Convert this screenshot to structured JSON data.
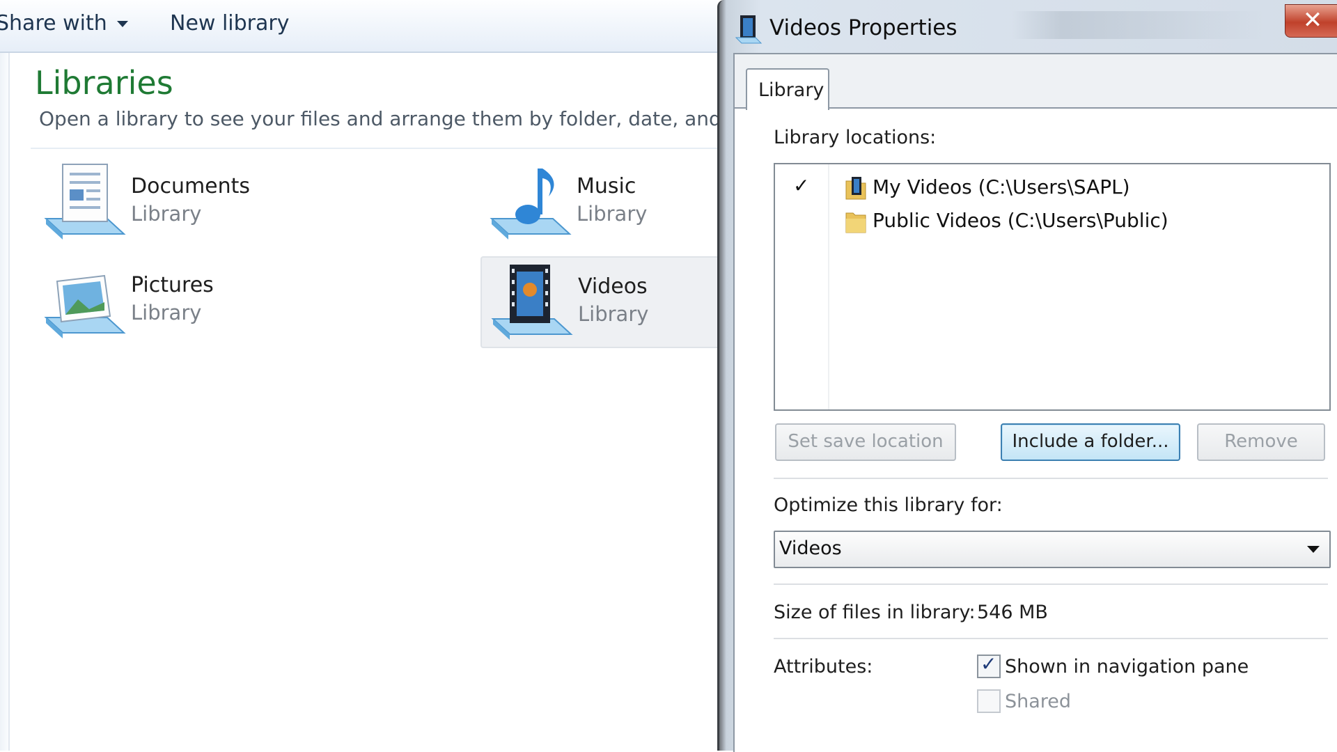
{
  "explorer": {
    "toolbar": {
      "share_with": "Share with",
      "new_library": "New library"
    },
    "title": "Libraries",
    "subtitle": "Open a library to see your files and arrange them by folder, date, and othe",
    "libraries": [
      {
        "name": "Documents",
        "type": "Library",
        "icon": "documents-library-icon"
      },
      {
        "name": "Music",
        "type": "Library",
        "icon": "music-library-icon"
      },
      {
        "name": "Pictures",
        "type": "Library",
        "icon": "pictures-library-icon"
      },
      {
        "name": "Videos",
        "type": "Library",
        "icon": "videos-library-icon",
        "selected": true
      }
    ]
  },
  "dialog": {
    "title": "Videos Properties",
    "close_glyph": "✕",
    "tab": "Library",
    "locations_label": "Library locations:",
    "locations": [
      {
        "check": "✓",
        "text": "My Videos (C:\\Users\\SAPL)",
        "icon": "videos-folder-icon"
      },
      {
        "check": "",
        "text": "Public Videos (C:\\Users\\Public)",
        "icon": "folder-icon"
      }
    ],
    "buttons": {
      "set_save": "Set save location",
      "include": "Include a folder...",
      "remove": "Remove"
    },
    "optimize_label": "Optimize this library for:",
    "optimize_value": "Videos",
    "size_label": "Size of files in library:",
    "size_value": "546 MB",
    "attributes_label": "Attributes:",
    "attributes": [
      {
        "label": "Shown in navigation pane",
        "checked": true
      },
      {
        "label": "Shared",
        "checked": false
      }
    ]
  },
  "colors": {
    "libraries_title": "#1f7a34",
    "close_button": "#c0412b",
    "primary_button_border": "#3c7fb1"
  }
}
